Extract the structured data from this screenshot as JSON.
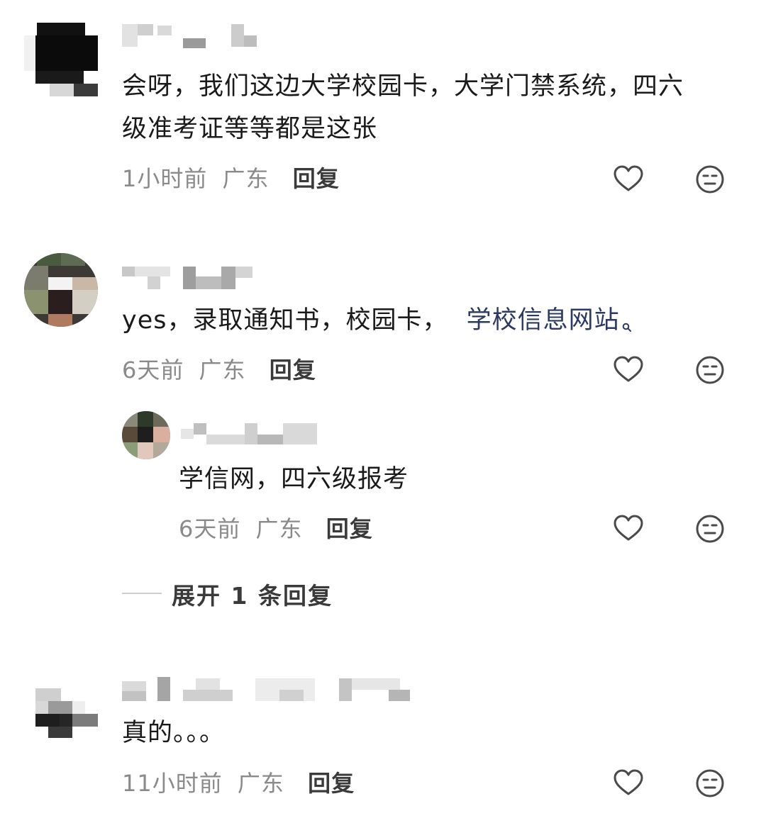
{
  "comments": [
    {
      "text": "会呀，我们这边大学校园卡，大学门禁系统，四六级准考证等等都是这张",
      "line1": "会呀，我们这边大学校园卡，大学门禁系统，四六",
      "line2": "级准考证等等都是这张",
      "time": "1小时前",
      "location": "广东",
      "reply_label": "回复"
    },
    {
      "text_prefix": "yes，录取通知书，校园卡，",
      "link_text": "学校信息网站",
      "time": "6天前",
      "location": "广东",
      "reply_label": "回复",
      "replies": [
        {
          "text": "学信网，四六级报考",
          "time": "6天前",
          "location": "广东",
          "reply_label": "回复"
        }
      ],
      "expand_label": "展开 1 条回复"
    },
    {
      "text": "真的。。。",
      "time": "11小时前",
      "location": "广东",
      "reply_label": "回复"
    }
  ],
  "icons": {
    "like": "heart-icon",
    "dislike": "neutral-face-icon",
    "search": "search-icon"
  },
  "colors": {
    "meta_text": "#8a8a8a",
    "link": "#2b3a63",
    "icon_stroke": "#4a4a4a"
  }
}
